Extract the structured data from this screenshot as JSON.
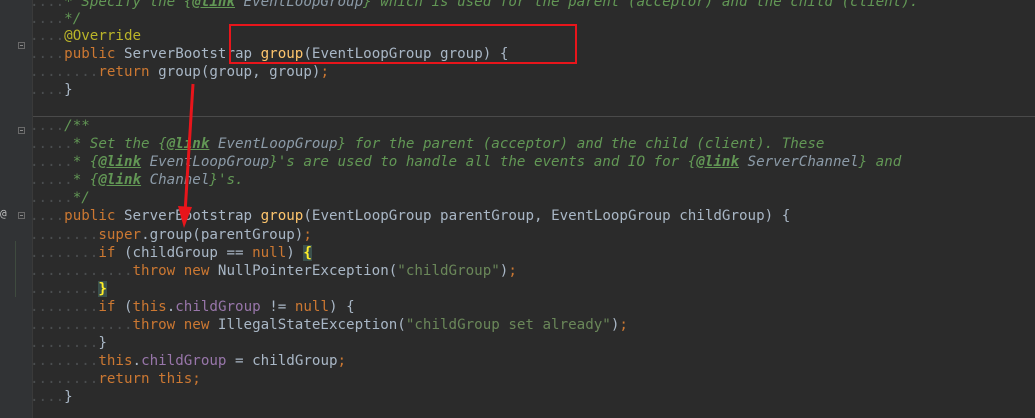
{
  "editor": {
    "colors": {
      "background": "#2b2b2b",
      "keyword": "#cc7832",
      "method": "#ffc66d",
      "field": "#9876aa",
      "string": "#6a8759",
      "annotation": "#bbb529",
      "doc": "#629755",
      "annotation_highlight": "#e8151b"
    },
    "gutter": {
      "override_marker": "@",
      "fold_markers": [
        "fold-icon",
        "fold-icon",
        "fold-icon"
      ]
    },
    "lines": [
      [
        {
          "c": "ws",
          "t": "...."
        },
        {
          "c": "doc",
          "t": "* Specify the {"
        },
        {
          "c": "doctag",
          "t": "@link"
        },
        {
          "c": "docref",
          "t": " EventLoopGroup"
        },
        {
          "c": "doc",
          "t": "} which is used for the parent (acceptor) and the child (client)."
        }
      ],
      [
        {
          "c": "ws",
          "t": "...."
        },
        {
          "c": "doc",
          "t": "*/"
        }
      ],
      [
        {
          "c": "ws",
          "t": "...."
        },
        {
          "c": "ann",
          "t": "@Override"
        }
      ],
      [
        {
          "c": "ws",
          "t": "...."
        },
        {
          "c": "kw",
          "t": "public "
        },
        {
          "c": "plain",
          "t": "ServerBootstrap "
        },
        {
          "c": "fn",
          "t": "group"
        },
        {
          "c": "plain",
          "t": "(EventLoopGroup group) {"
        }
      ],
      [
        {
          "c": "ws",
          "t": "........"
        },
        {
          "c": "kw",
          "t": "return "
        },
        {
          "c": "plain",
          "t": "group(group, group)"
        },
        {
          "c": "kw",
          "t": ";"
        }
      ],
      [
        {
          "c": "ws",
          "t": "...."
        },
        {
          "c": "plain",
          "t": "}"
        }
      ],
      [
        {
          "c": "ws",
          "t": ""
        }
      ],
      [
        {
          "c": "ws",
          "t": "...."
        },
        {
          "c": "doc",
          "t": "/**"
        }
      ],
      [
        {
          "c": "ws",
          "t": "....."
        },
        {
          "c": "doc",
          "t": "* Set the {"
        },
        {
          "c": "doctag",
          "t": "@link"
        },
        {
          "c": "docref",
          "t": " EventLoopGroup"
        },
        {
          "c": "doc",
          "t": "} for the parent (acceptor) and the child (client). These"
        }
      ],
      [
        {
          "c": "ws",
          "t": "....."
        },
        {
          "c": "doc",
          "t": "* {"
        },
        {
          "c": "doctag",
          "t": "@link"
        },
        {
          "c": "docref",
          "t": " EventLoopGroup"
        },
        {
          "c": "doc",
          "t": "}'s are used to handle all the events and IO for {"
        },
        {
          "c": "doctag",
          "t": "@link"
        },
        {
          "c": "docref",
          "t": " ServerChannel"
        },
        {
          "c": "doc",
          "t": "} and"
        }
      ],
      [
        {
          "c": "ws",
          "t": "....."
        },
        {
          "c": "doc",
          "t": "* {"
        },
        {
          "c": "doctag",
          "t": "@link"
        },
        {
          "c": "docref",
          "t": " Channel"
        },
        {
          "c": "doc",
          "t": "}'s."
        }
      ],
      [
        {
          "c": "ws",
          "t": "....."
        },
        {
          "c": "doc",
          "t": "*/"
        }
      ],
      [
        {
          "c": "ws",
          "t": "...."
        },
        {
          "c": "kw",
          "t": "public "
        },
        {
          "c": "plain",
          "t": "ServerBootstrap "
        },
        {
          "c": "fn",
          "t": "group"
        },
        {
          "c": "plain",
          "t": "(EventLoopGroup parentGroup, EventLoopGroup childGroup) {"
        }
      ],
      [
        {
          "c": "ws",
          "t": "........"
        },
        {
          "c": "kw",
          "t": "super"
        },
        {
          "c": "plain",
          "t": ".group(parentGroup)"
        },
        {
          "c": "kw",
          "t": ";"
        }
      ],
      [
        {
          "c": "ws",
          "t": "........"
        },
        {
          "c": "kw",
          "t": "if "
        },
        {
          "c": "plain",
          "t": "(childGroup == "
        },
        {
          "c": "kw",
          "t": "null"
        },
        {
          "c": "plain",
          "t": ") "
        },
        {
          "c": "bracehl",
          "t": "{"
        }
      ],
      [
        {
          "c": "ws",
          "t": "............"
        },
        {
          "c": "kw",
          "t": "throw new "
        },
        {
          "c": "plain",
          "t": "NullPointerException("
        },
        {
          "c": "str",
          "t": "\"childGroup\""
        },
        {
          "c": "plain",
          "t": ")"
        },
        {
          "c": "kw",
          "t": ";"
        }
      ],
      [
        {
          "c": "ws",
          "t": "........"
        },
        {
          "c": "bracehl",
          "t": "}"
        }
      ],
      [
        {
          "c": "ws",
          "t": "........"
        },
        {
          "c": "kw",
          "t": "if "
        },
        {
          "c": "plain",
          "t": "("
        },
        {
          "c": "kw",
          "t": "this"
        },
        {
          "c": "plain",
          "t": "."
        },
        {
          "c": "field",
          "t": "childGroup"
        },
        {
          "c": "plain",
          "t": " != "
        },
        {
          "c": "kw",
          "t": "null"
        },
        {
          "c": "plain",
          "t": ") {"
        }
      ],
      [
        {
          "c": "ws",
          "t": "............"
        },
        {
          "c": "kw",
          "t": "throw new "
        },
        {
          "c": "plain",
          "t": "IllegalStateException("
        },
        {
          "c": "str",
          "t": "\"childGroup set already\""
        },
        {
          "c": "plain",
          "t": ")"
        },
        {
          "c": "kw",
          "t": ";"
        }
      ],
      [
        {
          "c": "ws",
          "t": "........"
        },
        {
          "c": "plain",
          "t": "}"
        }
      ],
      [
        {
          "c": "ws",
          "t": "........"
        },
        {
          "c": "kw",
          "t": "this"
        },
        {
          "c": "plain",
          "t": "."
        },
        {
          "c": "field",
          "t": "childGroup"
        },
        {
          "c": "plain",
          "t": " = childGroup"
        },
        {
          "c": "kw",
          "t": ";"
        }
      ],
      [
        {
          "c": "ws",
          "t": "........"
        },
        {
          "c": "kw",
          "t": "return this;"
        }
      ],
      [
        {
          "c": "ws",
          "t": "...."
        },
        {
          "c": "plain",
          "t": "}"
        }
      ]
    ]
  }
}
